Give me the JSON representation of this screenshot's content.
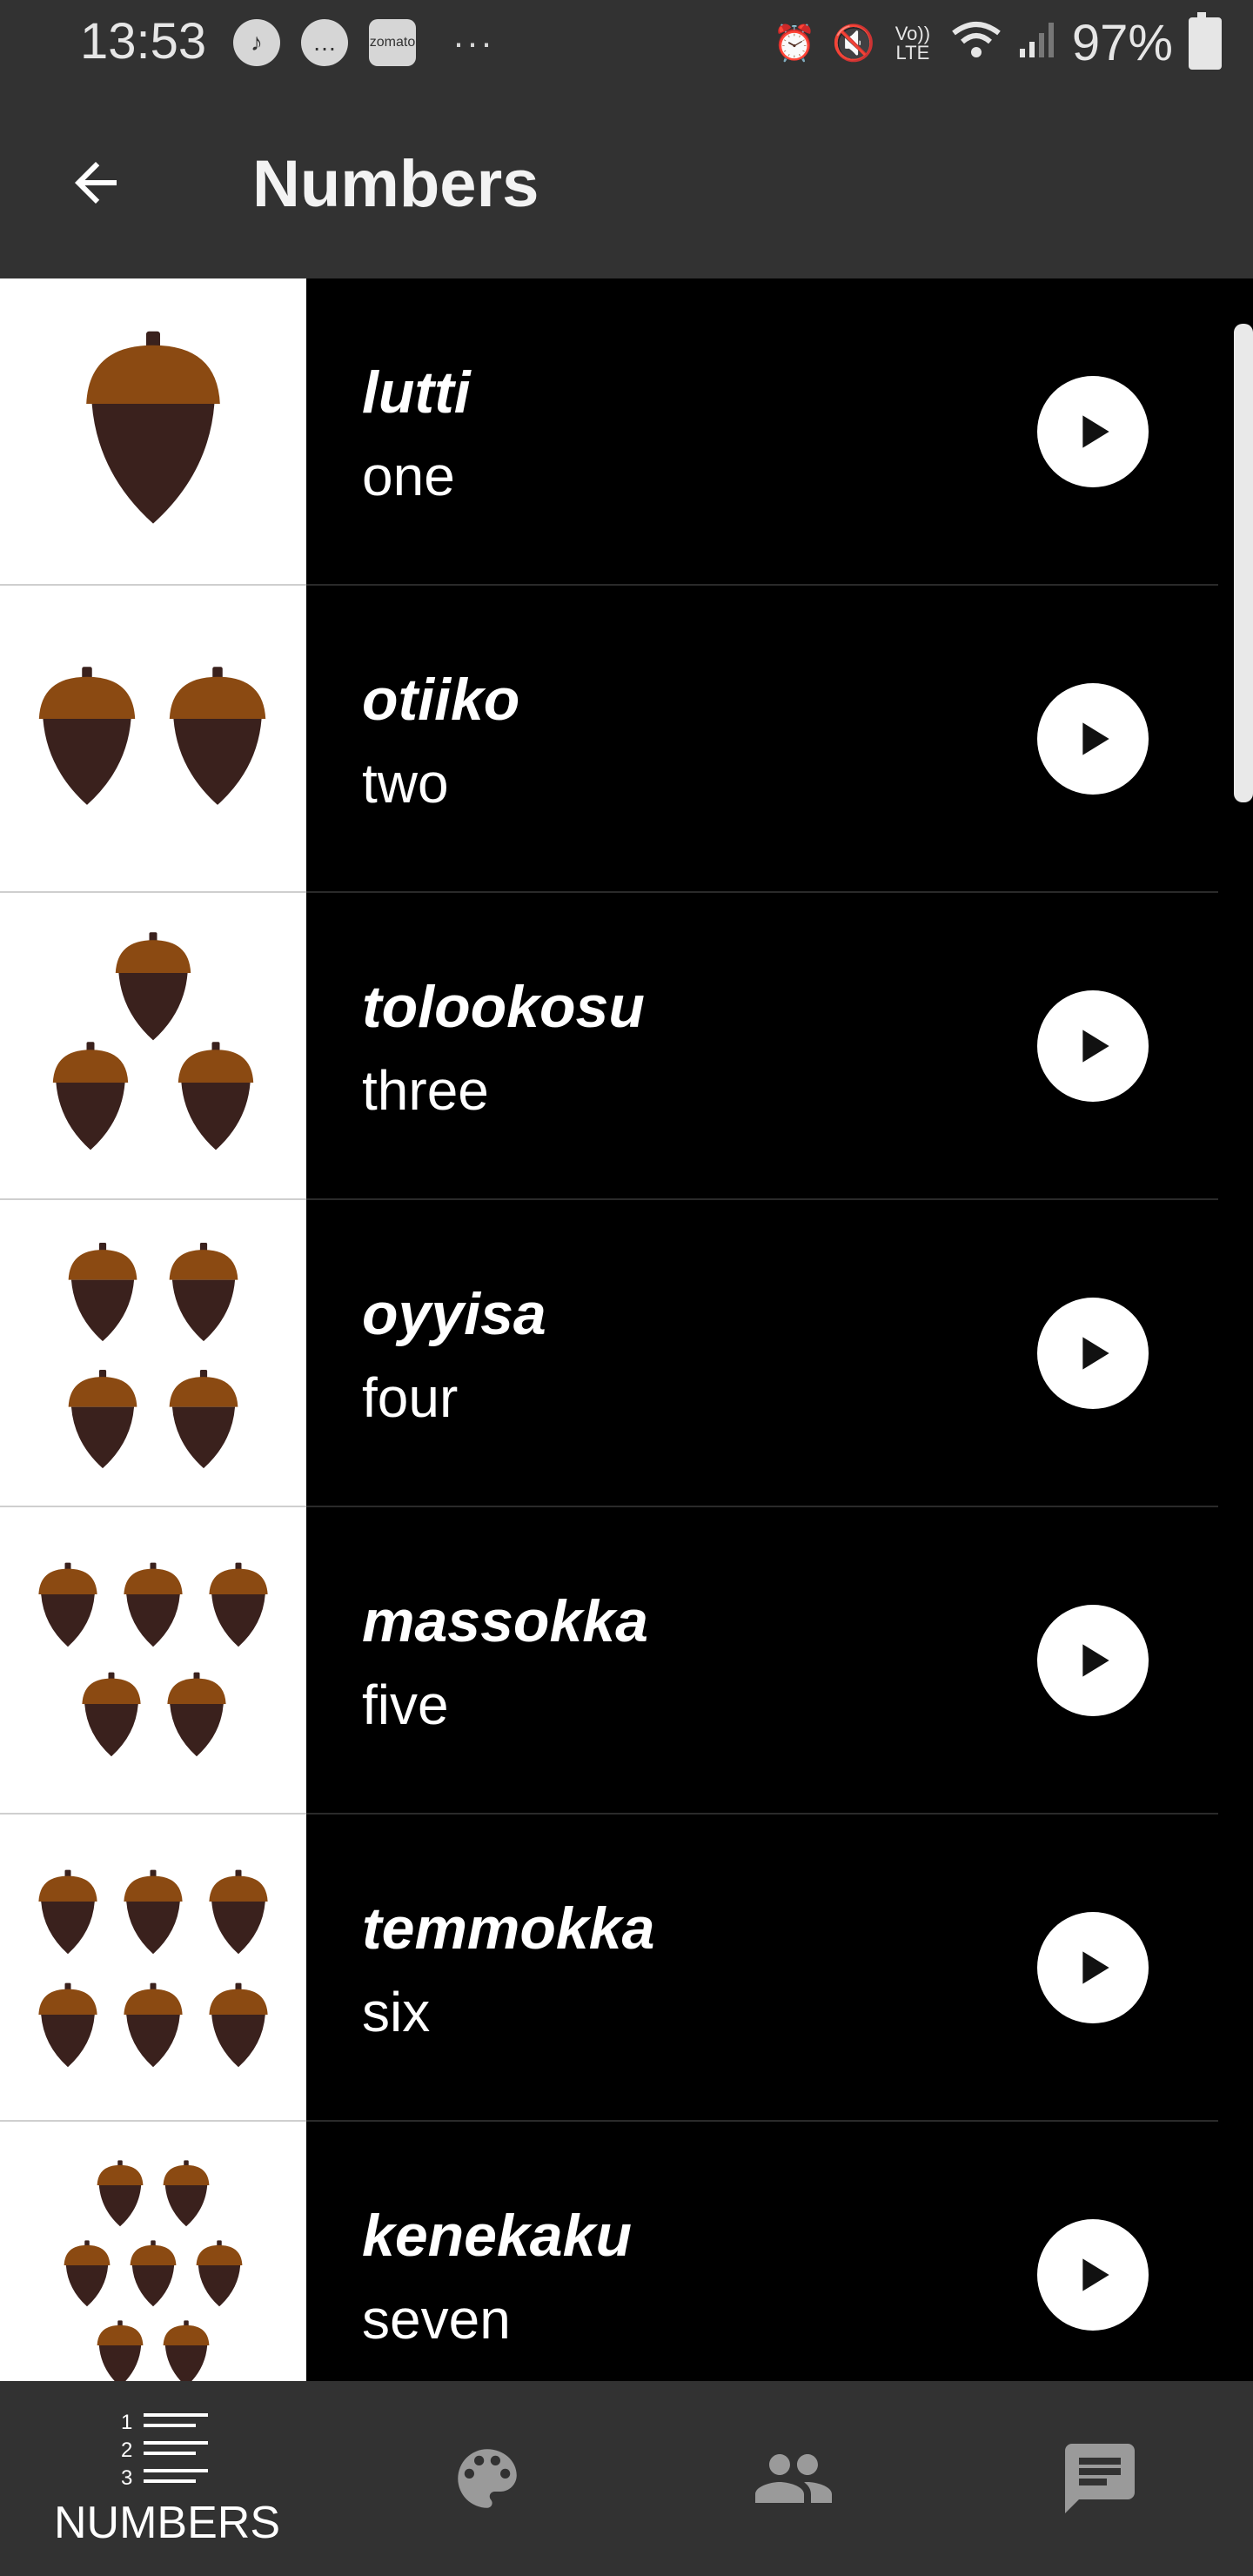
{
  "status_bar": {
    "time": "13:53",
    "left_icons": [
      "saavn-icon",
      "message-icon",
      "zomato-icon"
    ],
    "zomato_text": "zomato",
    "more": "···",
    "battery": "97%",
    "volte": "Vo)) LTE"
  },
  "app_bar": {
    "title": "Numbers"
  },
  "colors": {
    "bar": "#323232",
    "background": "#000000",
    "acorn_cap": "#8B4A12",
    "acorn_body": "#3A211D"
  },
  "items": [
    {
      "native": "lutti",
      "english": "one",
      "count": 1
    },
    {
      "native": "otiiko",
      "english": "two",
      "count": 2
    },
    {
      "native": "tolookosu",
      "english": "three",
      "count": 3
    },
    {
      "native": "oyyisa",
      "english": "four",
      "count": 4
    },
    {
      "native": "massokka",
      "english": "five",
      "count": 5
    },
    {
      "native": "temmokka",
      "english": "six",
      "count": 6
    },
    {
      "native": "kenekaku",
      "english": "seven",
      "count": 7
    }
  ],
  "bottom_nav": {
    "items": [
      {
        "label": "NUMBERS",
        "icon": "numbered-list-icon",
        "active": true,
        "icon_digits": [
          "1",
          "2",
          "3"
        ]
      },
      {
        "label": "",
        "icon": "palette-icon",
        "active": false
      },
      {
        "label": "",
        "icon": "people-icon",
        "active": false
      },
      {
        "label": "",
        "icon": "chat-message-icon",
        "active": false
      }
    ]
  }
}
